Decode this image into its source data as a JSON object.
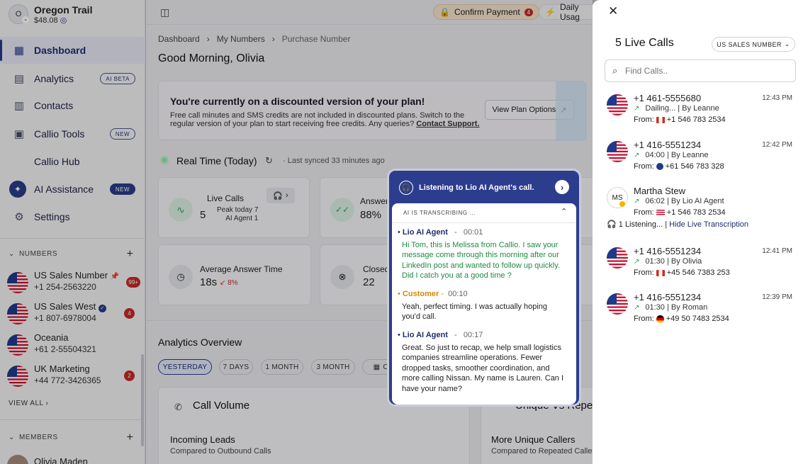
{
  "account": {
    "initial": "O",
    "name": "Oregon Trail",
    "balance": "$48.08"
  },
  "nav": [
    {
      "label": "Dashboard",
      "icon": "dashboard-icon"
    },
    {
      "label": "Analytics",
      "badge": "AI BETA",
      "icon": "analytics-icon"
    },
    {
      "label": "Contacts",
      "icon": "contacts-icon"
    },
    {
      "label": "Callio Tools",
      "badge": "NEW",
      "icon": "tools-icon"
    },
    {
      "label": "Callio Hub"
    },
    {
      "label": "AI Assistance",
      "badge": "NEW",
      "icon": "ai-icon"
    },
    {
      "label": "Settings",
      "icon": "settings-icon"
    }
  ],
  "numbers_header": "NUMBERS",
  "numbers": [
    {
      "name": "US Sales Number",
      "phone": "+1 254-2563220",
      "count": "99+"
    },
    {
      "name": "US Sales West",
      "phone": "+1 807-6978004",
      "count": "4"
    },
    {
      "name": "Oceania",
      "phone": "+61 2-55504321"
    },
    {
      "name": "UK Marketing",
      "phone": "+44 772-3426365",
      "count": "2"
    }
  ],
  "view_all": "VIEW ALL",
  "members_header": "MEMBERS",
  "member": "Olivia Maden",
  "topbar": {
    "confirm": "Confirm Payment",
    "confirm_count": "4",
    "daily": "Daily Usag"
  },
  "breadcrumb": [
    "Dashboard",
    "My Numbers",
    "Purchase Number"
  ],
  "greeting": "Good Morning, Olivia",
  "banner": {
    "title": "You're currently on a discounted version of your plan!",
    "text": "Free call minutes and SMS credits are not included in discounted plans. Switch to the regular version of your plan to start receiving free credits. Any queries?",
    "link": "Contact Support.",
    "button": "View Plan Options"
  },
  "realtime": {
    "title": "Real Time (Today)",
    "synced": "Last synced 33 minutes ago"
  },
  "stats": {
    "live_calls": {
      "label": "Live Calls",
      "value": "5",
      "peak": "Peak today 7",
      "agent": "AI Agent 1"
    },
    "answer": {
      "label": "Answer",
      "value": "88%"
    },
    "avg": {
      "label": "Average Answer Time",
      "value": "18s",
      "delta": "8%"
    },
    "closed": {
      "label": "Closed",
      "value": "22"
    }
  },
  "analytics": {
    "title": "Analytics Overview",
    "tabs": [
      "YESTERDAY",
      "7 DAYS",
      "1 MONTH",
      "3 MONTH",
      "CU"
    ],
    "call_volume": "Call Volume",
    "unique": "Unique Vs Repea",
    "incoming": "Incoming Leads",
    "incoming_sub": "Compared to Outbound Calls",
    "more_unique": "More Unique Callers",
    "more_unique_sub": "Compared to Repeated Calle"
  },
  "popup": {
    "title": "Listening to Lio AI Agent's call.",
    "status": "AI IS TRANSCRIBING ...",
    "lines": [
      {
        "speaker": "Lio AI Agent",
        "time": "00:01",
        "text": "Hi Tom, this is Melissa from Callio. I saw your message come through this morning after our LinkedIn post and wanted to follow up quickly. Did I catch you at a good time ?"
      },
      {
        "speaker": "Customer",
        "time": "00:10",
        "text": "Yeah, perfect timing. I was actually hoping you'd call."
      },
      {
        "speaker": "Lio AI Agent",
        "time": "00:17",
        "text": "Great. So just to recap, we help small logistics companies streamline operations. Fewer dropped tasks, smoother coordination, and more calling Nissan. My name is Lauren. Can I have your name?"
      }
    ]
  },
  "panel": {
    "title": "5 Live Calls",
    "filter": "US SALES NUMBER",
    "search_placeholder": "Find Calls..",
    "calls": [
      {
        "phone": "+1 461-5555680",
        "time": "12:43 PM",
        "status": "Dailing...",
        "by": "By Leanne",
        "from": "+1 546 783 2534",
        "flag": "ca"
      },
      {
        "phone": "+1 416-5551234",
        "time": "12:42 PM",
        "status": "04:00",
        "by": "By Leanne",
        "from": "+61 546 783 328",
        "flag": "au"
      },
      {
        "phone": "Martha Stew",
        "initials": "MS",
        "status": "06:02",
        "by": "By Lio AI Agent",
        "from": "+1 546 783 2534",
        "flag": "us",
        "listening": "1 Listening...",
        "hide": "Hide Live Transcription"
      },
      {
        "phone": "+1 416-5551234",
        "time": "12:41 PM",
        "status": "01:30",
        "by": "By Olivia",
        "from": "+45 546 7383 253",
        "flag": "ca"
      },
      {
        "phone": "+1 416-5551234",
        "time": "12:39 PM",
        "status": "01:30",
        "by": "By Roman",
        "from": "+49 50 7483 2534",
        "flag": "de"
      }
    ],
    "from_label": "From:"
  }
}
